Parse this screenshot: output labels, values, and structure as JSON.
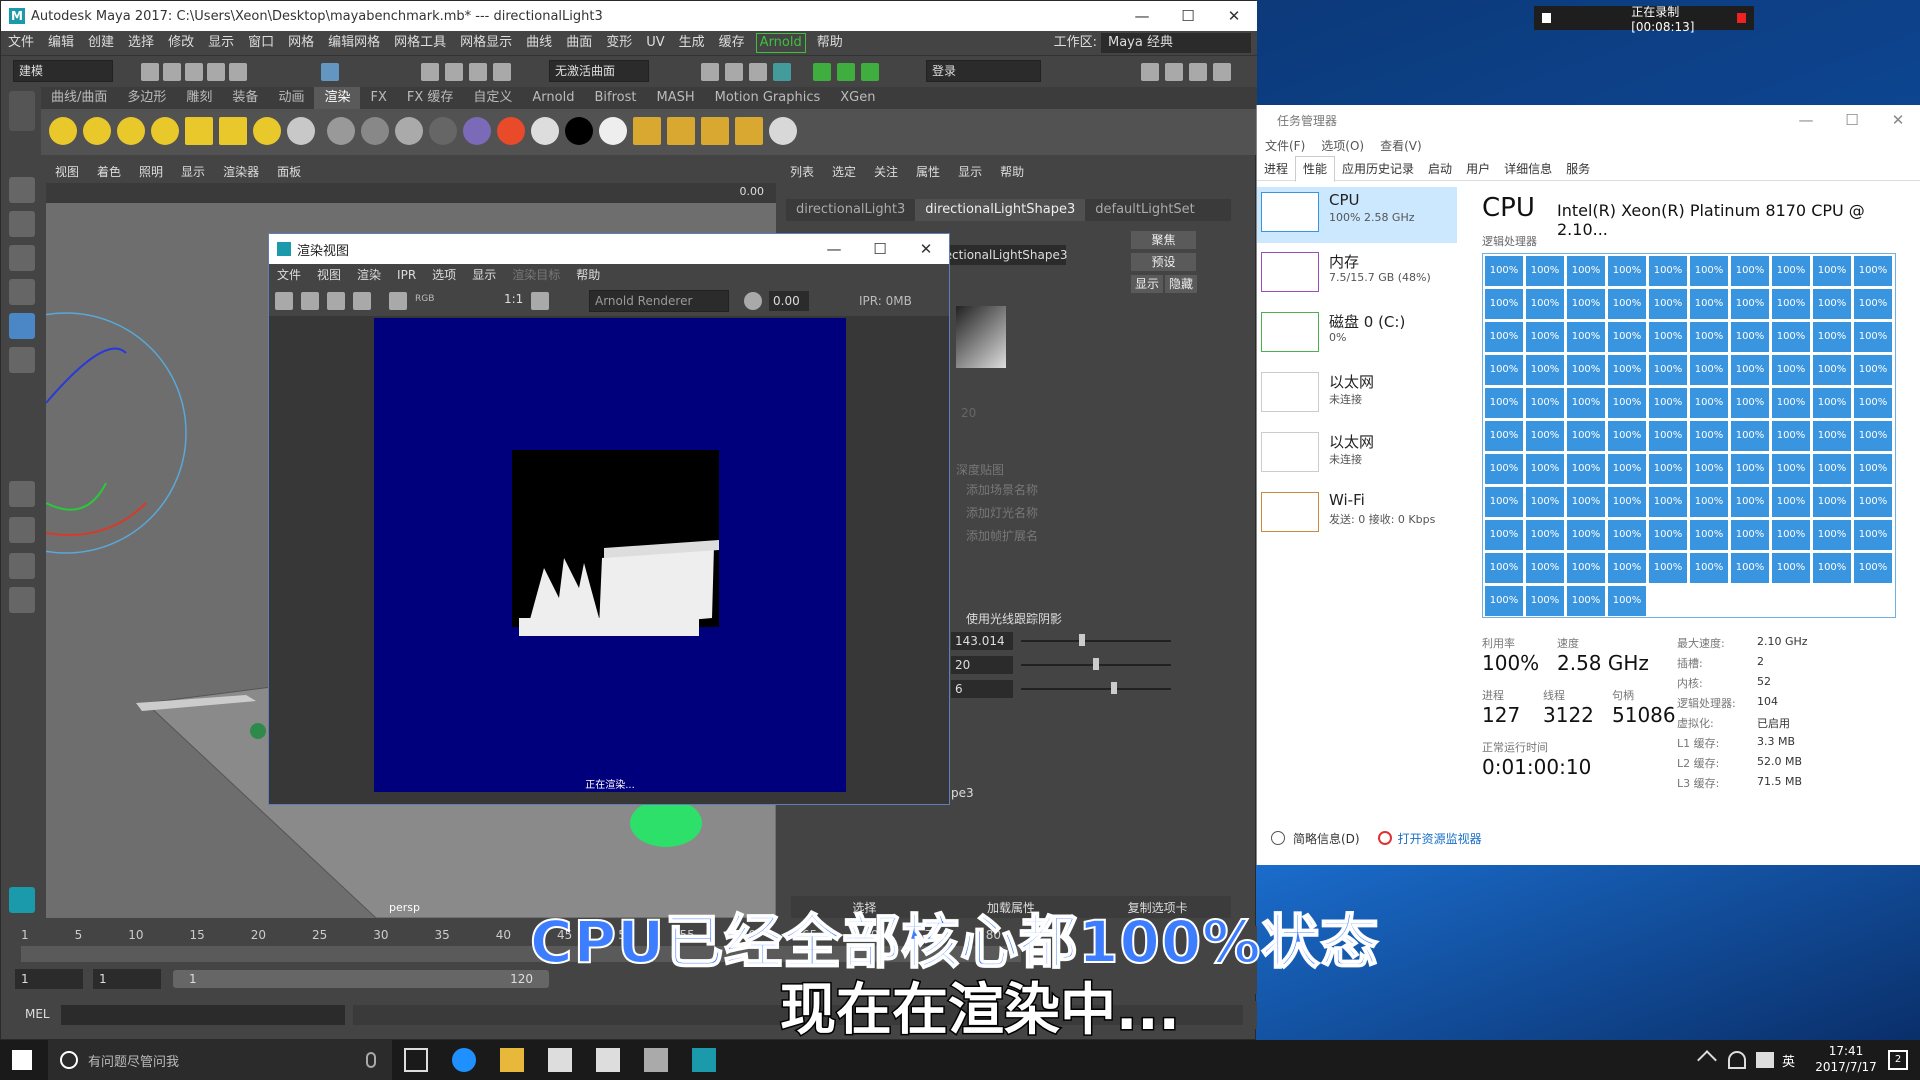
{
  "maya": {
    "title": "Autodesk Maya 2017: C:\\Users\\Xeon\\Desktop\\mayabenchmark.mb*   ---   directionalLight3",
    "menu": [
      "文件",
      "编辑",
      "创建",
      "选择",
      "修改",
      "显示",
      "窗口",
      "网格",
      "编辑网格",
      "网格工具",
      "网格显示",
      "曲线",
      "曲面",
      "变形",
      "UV",
      "生成",
      "缓存"
    ],
    "menu_arnold": "Arnold",
    "menu_help": "帮助",
    "workspace_label": "工作区:",
    "workspace_value": "Maya 经典",
    "mode_dropdown": "建模",
    "live_surface": "无激活曲面",
    "login": "登录",
    "shelf_tabs": [
      "曲线/曲面",
      "多边形",
      "雕刻",
      "装备",
      "动画",
      "渲染",
      "FX",
      "FX 缓存",
      "自定义",
      "Arnold",
      "Bifrost",
      "MASH",
      "Motion Graphics",
      "XGen"
    ],
    "shelf_active": "渲染",
    "viewport_menu": [
      "视图",
      "着色",
      "照明",
      "显示",
      "渲染器",
      "面板"
    ],
    "viewport_value": "0.00",
    "persp_label": "persp",
    "ae_menu": [
      "列表",
      "选定",
      "关注",
      "属性",
      "显示",
      "帮助"
    ],
    "ae_tabs": [
      "directionalLight3",
      "directionalLightShape3",
      "defaultLightSet"
    ],
    "ae_active_tab": "directionalLightShape3",
    "ae_node_field": "rectionalLightShape3",
    "ae_buttons": [
      "聚焦",
      "预设",
      "显示",
      "隐藏"
    ],
    "ae_rows": [
      "深度贴图",
      "添加场景名称",
      "添加灯光名称",
      "添加帧扩展名"
    ],
    "ae_raytrace": "使用光线跟踪阴影",
    "ae_values": [
      "143.014",
      "20",
      "6"
    ],
    "ae_val_top": "20",
    "ae_footer": "pe3",
    "ae_bottom_btns": [
      "选择",
      "加载属性",
      "复制选项卡"
    ],
    "timeline_ticks": [
      "1",
      "5",
      "10",
      "15",
      "20",
      "25",
      "30",
      "35",
      "40",
      "45",
      "50",
      "55",
      "60",
      "65",
      "70",
      "75",
      "80"
    ],
    "range_start": "1",
    "range_start2": "1",
    "range_inner_start": "1",
    "range_inner_end": "120",
    "mel_label": "MEL"
  },
  "render_view": {
    "title": "渲染视图",
    "menu": [
      "文件",
      "视图",
      "渲染",
      "IPR",
      "选项",
      "显示"
    ],
    "menu_dim": "渲染目标",
    "menu_help": "帮助",
    "rgb": "RGB",
    "ratio": "1:1",
    "renderer": "Arnold Renderer",
    "exposure": "0.00",
    "ipr": "IPR: 0MB",
    "status": "正在渲染..."
  },
  "task_manager": {
    "title": "任务管理器",
    "menu": [
      "文件(F)",
      "选项(O)",
      "查看(V)"
    ],
    "tabs": [
      "进程",
      "性能",
      "应用历史记录",
      "启动",
      "用户",
      "详细信息",
      "服务"
    ],
    "active_tab": "性能",
    "side": [
      {
        "name": "CPU",
        "detail": "100% 2.58 GHz"
      },
      {
        "name": "内存",
        "detail": "7.5/15.7 GB (48%)"
      },
      {
        "name": "磁盘 0 (C:)",
        "detail": "0%"
      },
      {
        "name": "以太网",
        "detail": "未连接"
      },
      {
        "name": "以太网",
        "detail": "未连接"
      },
      {
        "name": "Wi-Fi",
        "detail": "发送: 0 接收: 0 Kbps"
      }
    ],
    "cpu_heading": "CPU",
    "cpu_model": "Intel(R) Xeon(R) Platinum 8170 CPU @ 2.10...",
    "grid_label": "逻辑处理器",
    "cell_value": "100%",
    "cell_count": 104,
    "stats": {
      "util_label": "利用率",
      "util": "100%",
      "speed_label": "速度",
      "speed": "2.58 GHz",
      "proc_label": "进程",
      "proc": "127",
      "thread_label": "线程",
      "thread": "3122",
      "handle_label": "句柄",
      "handle": "51086",
      "uptime_label": "正常运行时间",
      "uptime": "0:01:00:10"
    },
    "specs": [
      [
        "最大速度:",
        "2.10 GHz"
      ],
      [
        "插槽:",
        "2"
      ],
      [
        "内核:",
        "52"
      ],
      [
        "逻辑处理器:",
        "104"
      ],
      [
        "虚拟化:",
        "已启用"
      ],
      [
        "L1 缓存:",
        "3.3 MB"
      ],
      [
        "L2 缓存:",
        "52.0 MB"
      ],
      [
        "L3 缓存:",
        "71.5 MB"
      ]
    ],
    "footer_summary": "简略信息(D)",
    "footer_monitor": "打开资源监视器"
  },
  "subtitles": {
    "line1": "CPU已经全部核心都100%状态",
    "line2": "现在在渲染中..."
  },
  "recorder": {
    "status": "正在录制 [00:08:13]"
  },
  "taskbar": {
    "search": "有问题尽管问我",
    "time": "17:41",
    "date": "2017/7/17",
    "ime": "英",
    "notif": "2"
  },
  "colors": {
    "cpu_cell": "#3a95e0",
    "render_bg": "#00007d",
    "maya_teal": "#1a9aaa",
    "subtitle_blue": "#3d7dff"
  }
}
